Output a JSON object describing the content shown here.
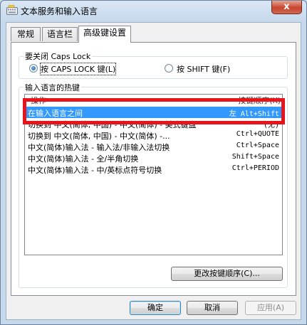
{
  "window": {
    "title": "文本服务和输入语言",
    "close_glyph": "x",
    "app_icon": "keyboard-icon"
  },
  "tabs": [
    {
      "label": "常规",
      "active": false
    },
    {
      "label": "语言栏",
      "active": false
    },
    {
      "label": "高级键设置",
      "active": true
    }
  ],
  "caps_lock_group": {
    "label": "要关闭 Caps Lock",
    "option_capslock": "按 CAPS LOCK 键(L)",
    "option_shift": "按 SHIFT 键(F)",
    "selected": "capslock"
  },
  "hotkeys_group": {
    "label": "输入语言的热键",
    "col_action": "操作",
    "col_keys": "按键顺序(K)",
    "rows": [
      {
        "action": "在输入语言之间",
        "keys": "左 Alt+Shift",
        "selected": true
      },
      {
        "action": "切换到 中文(简体, 中国) - 中文(简体) - 美式键盘",
        "keys": "(无)",
        "selected": false
      },
      {
        "action": "切换到 中文(简体, 中国) - 中文(简体) -...",
        "keys": "Ctrl+QUOTE",
        "selected": false
      },
      {
        "action": "中文(简体)输入法 - 输入法/非输入法切换",
        "keys": "Ctrl+Space",
        "selected": false
      },
      {
        "action": "中文(简体)输入法 - 全/半角切换",
        "keys": "Shift+Space",
        "selected": false
      },
      {
        "action": "中文(简体)输入法 - 中/英标点符号切换",
        "keys": "Ctrl+PERIOD",
        "selected": false
      }
    ],
    "change_button": "更改按键顺序(C)..."
  },
  "footer": {
    "ok": "确定",
    "cancel": "取消",
    "apply": "应用(A)"
  },
  "colors": {
    "selection": "#3399ff",
    "annotation_box": "#e8141b"
  }
}
